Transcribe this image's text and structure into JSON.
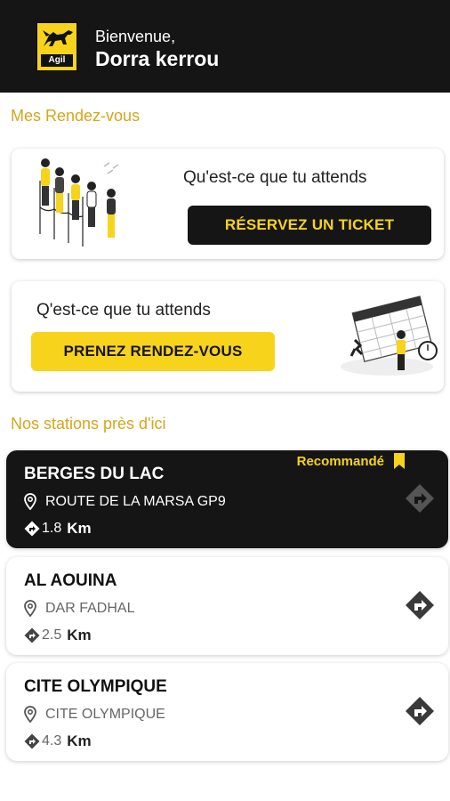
{
  "header": {
    "logo_text": "Agil",
    "greeting": "Bienvenue,",
    "user_name": "Dorra kerrou"
  },
  "appointments": {
    "section_title": "Mes Rendez-vous",
    "ticket_card": {
      "prompt": "Qu'est-ce que tu attends",
      "button_label": "RÉSERVEZ UN TICKET"
    },
    "appointment_card": {
      "prompt": "Q'est-ce que tu attends",
      "button_label": "PRENEZ RENDEZ-VOUS"
    }
  },
  "stations": {
    "section_title": "Nos stations près d'ici",
    "recommended_label": "Recommandé",
    "items": [
      {
        "name": "BERGES DU LAC",
        "address": "ROUTE DE LA MARSA GP9",
        "distance": "1.8",
        "unit": "Km",
        "recommended": true
      },
      {
        "name": "AL AOUINA",
        "address": "DAR FADHAL",
        "distance": "2.5",
        "unit": "Km",
        "recommended": false
      },
      {
        "name": "CITE OLYMPIQUE",
        "address": "CITE OLYMPIQUE",
        "distance": "4.3",
        "unit": "Km",
        "recommended": false
      }
    ]
  },
  "icons": {
    "logo": "dog-logo-icon",
    "location": "location-pin-icon",
    "distance": "directions-diamond-icon",
    "navigate": "directions-icon",
    "bookmark": "bookmark-icon"
  },
  "colors": {
    "brand_yellow": "#f7d31c",
    "dark": "#151515",
    "section_title": "#d6a51b"
  }
}
